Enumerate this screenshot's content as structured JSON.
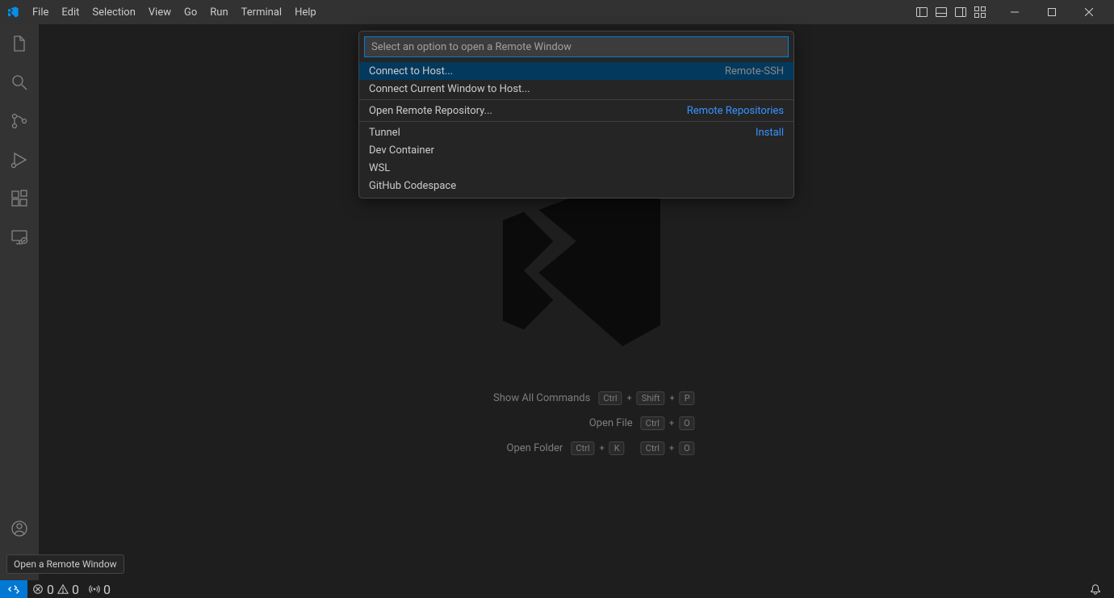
{
  "menu": [
    "File",
    "Edit",
    "Selection",
    "View",
    "Go",
    "Run",
    "Terminal",
    "Help"
  ],
  "quickpick": {
    "placeholder": "Select an option to open a Remote Window",
    "groups": [
      {
        "items": [
          {
            "label": "Connect to Host...",
            "hint": "Remote-SSH",
            "hintClass": "",
            "selected": true
          },
          {
            "label": "Connect Current Window to Host...",
            "hint": "",
            "hintClass": ""
          }
        ]
      },
      {
        "items": [
          {
            "label": "Open Remote Repository...",
            "hint": "Remote Repositories",
            "hintClass": "link"
          }
        ]
      },
      {
        "items": [
          {
            "label": "Tunnel",
            "hint": "Install",
            "hintClass": "link"
          },
          {
            "label": "Dev Container",
            "hint": "",
            "hintClass": ""
          },
          {
            "label": "WSL",
            "hint": "",
            "hintClass": ""
          },
          {
            "label": "GitHub Codespace",
            "hint": "",
            "hintClass": ""
          }
        ]
      }
    ]
  },
  "shortcuts": [
    {
      "label": "Show All Commands",
      "keys": [
        "Ctrl",
        "+",
        "Shift",
        "+",
        "P"
      ]
    },
    {
      "label": "Open File",
      "keys": [
        "Ctrl",
        "+",
        "O"
      ]
    },
    {
      "label": "Open Folder",
      "keys": [
        "Ctrl",
        "+",
        "K",
        " ",
        "Ctrl",
        "+",
        "O"
      ]
    }
  ],
  "status": {
    "errors": "0",
    "warnings": "0",
    "ports": "0"
  },
  "tooltip": "Open a Remote Window"
}
